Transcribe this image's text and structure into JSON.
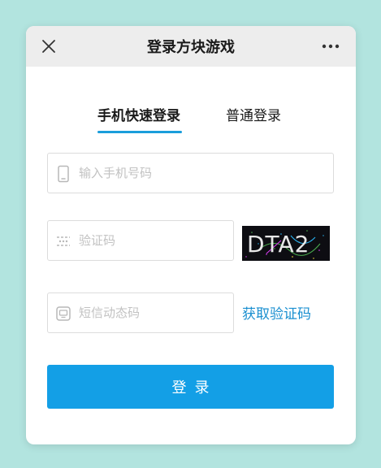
{
  "header": {
    "title": "登录方块游戏",
    "close_icon": "close-icon",
    "more_icon": "more-icon"
  },
  "tabs": [
    {
      "label": "手机快速登录",
      "active": true
    },
    {
      "label": "普通登录",
      "active": false
    }
  ],
  "form": {
    "phone": {
      "placeholder": "输入手机号码",
      "value": "",
      "icon": "phone-icon"
    },
    "captcha": {
      "placeholder": "验证码",
      "value": "",
      "icon": "captcha-icon",
      "image_text": "DTA2"
    },
    "sms": {
      "placeholder": "短信动态码",
      "value": "",
      "icon": "message-icon"
    },
    "get_code_label": "获取验证码",
    "submit_label": "登录"
  },
  "colors": {
    "background": "#b2e4df",
    "accent": "#139fe6",
    "link": "#1a8fd0",
    "titlebar": "#ededed"
  }
}
